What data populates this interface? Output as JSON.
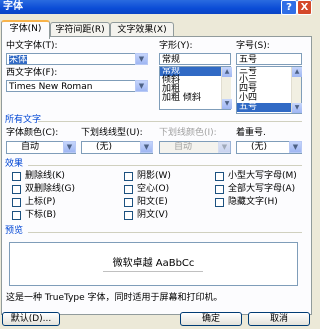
{
  "window": {
    "title": "字体",
    "help_label": "?",
    "close_label": "X"
  },
  "tabs": [
    {
      "label": "字体(N)",
      "active": true
    },
    {
      "label": "字符间距(R)",
      "active": false
    },
    {
      "label": "文字效果(X)",
      "active": false
    }
  ],
  "chinese_font": {
    "label": "中文字体(T):",
    "value": "宋体"
  },
  "western_font": {
    "label": "西文字体(F):",
    "value": "Times New Roman"
  },
  "style": {
    "label": "字形(Y):",
    "value": "常规",
    "options": [
      "常规",
      "倾斜",
      "加粗",
      "加粗 倾斜"
    ],
    "selected": "常规"
  },
  "size": {
    "label": "字号(S):",
    "value": "五号",
    "options": [
      "三号",
      "小三",
      "四号",
      "小四",
      "五号"
    ],
    "selected": "五号"
  },
  "all_text": {
    "group_label": "所有文字",
    "color": {
      "label": "字体颜色(C):",
      "value": "自动"
    },
    "underline": {
      "label": "下划线线型(U):",
      "value": "(无)"
    },
    "underline_color": {
      "label": "下划线颜色(I):",
      "value": "自动"
    },
    "emphasis": {
      "label": "着重号.",
      "value": "(无)"
    }
  },
  "effects": {
    "group_label": "效果",
    "items": [
      "删除线(K)",
      "阴影(W)",
      "小型大写字母(M)",
      "双删除线(G)",
      "空心(O)",
      "全部大写字母(A)",
      "上标(P)",
      "阳文(E)",
      "隐藏文字(H)",
      "下标(B)",
      "阴文(V)"
    ]
  },
  "preview": {
    "group_label": "预览",
    "text": "微软卓越 AaBbCc"
  },
  "note": "这是一种 TrueType 字体，同时适用于屏幕和打印机。",
  "buttons": {
    "default": "默认(D)...",
    "ok": "确定",
    "cancel": "取消"
  },
  "colors": {
    "accent": "#316ac5",
    "group_title": "#0046d5",
    "titlebar": "#0b4cd6"
  }
}
